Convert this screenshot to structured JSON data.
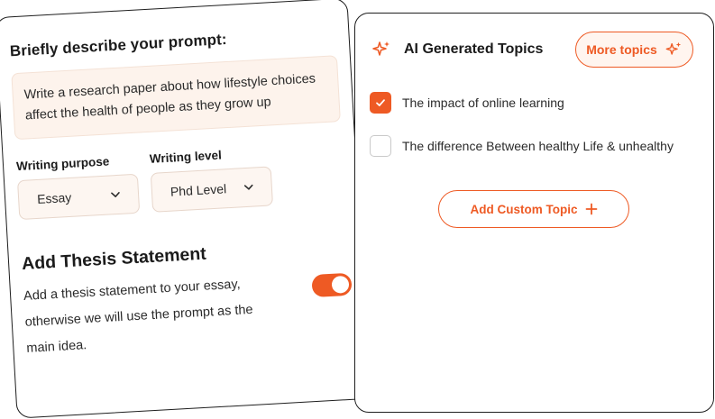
{
  "colors": {
    "accent": "#ee5a24",
    "accent_soft": "#fff5ef",
    "prompt_bg": "#fdf3ec",
    "border": "#1e1e1e"
  },
  "prompt_panel": {
    "heading": "Briefly describe your prompt:",
    "prompt_text": "Write a research paper about how lifestyle choices affect the health of people as they grow up",
    "writing_purpose": {
      "label": "Writing purpose",
      "value": "Essay",
      "icon": "chevron-down-icon"
    },
    "writing_level": {
      "label": "Writing level",
      "value": "Phd Level",
      "icon": "chevron-down-icon"
    },
    "thesis": {
      "heading": "Add Thesis Statement",
      "description": "Add a thesis statement to your essay, otherwise we will use the prompt as the main idea.",
      "toggle_on": true
    }
  },
  "topics_panel": {
    "title": "AI Generated Topics",
    "title_icon": "sparkle-icon",
    "more_button": {
      "label": "More topics",
      "icon": "sparkle-icon"
    },
    "topics": [
      {
        "label": "The impact of online learning",
        "checked": true
      },
      {
        "label": "The difference Between healthy Life & unhealthy",
        "checked": false
      }
    ],
    "add_button": {
      "label": "Add Custom Topic",
      "icon": "plus-icon"
    }
  }
}
